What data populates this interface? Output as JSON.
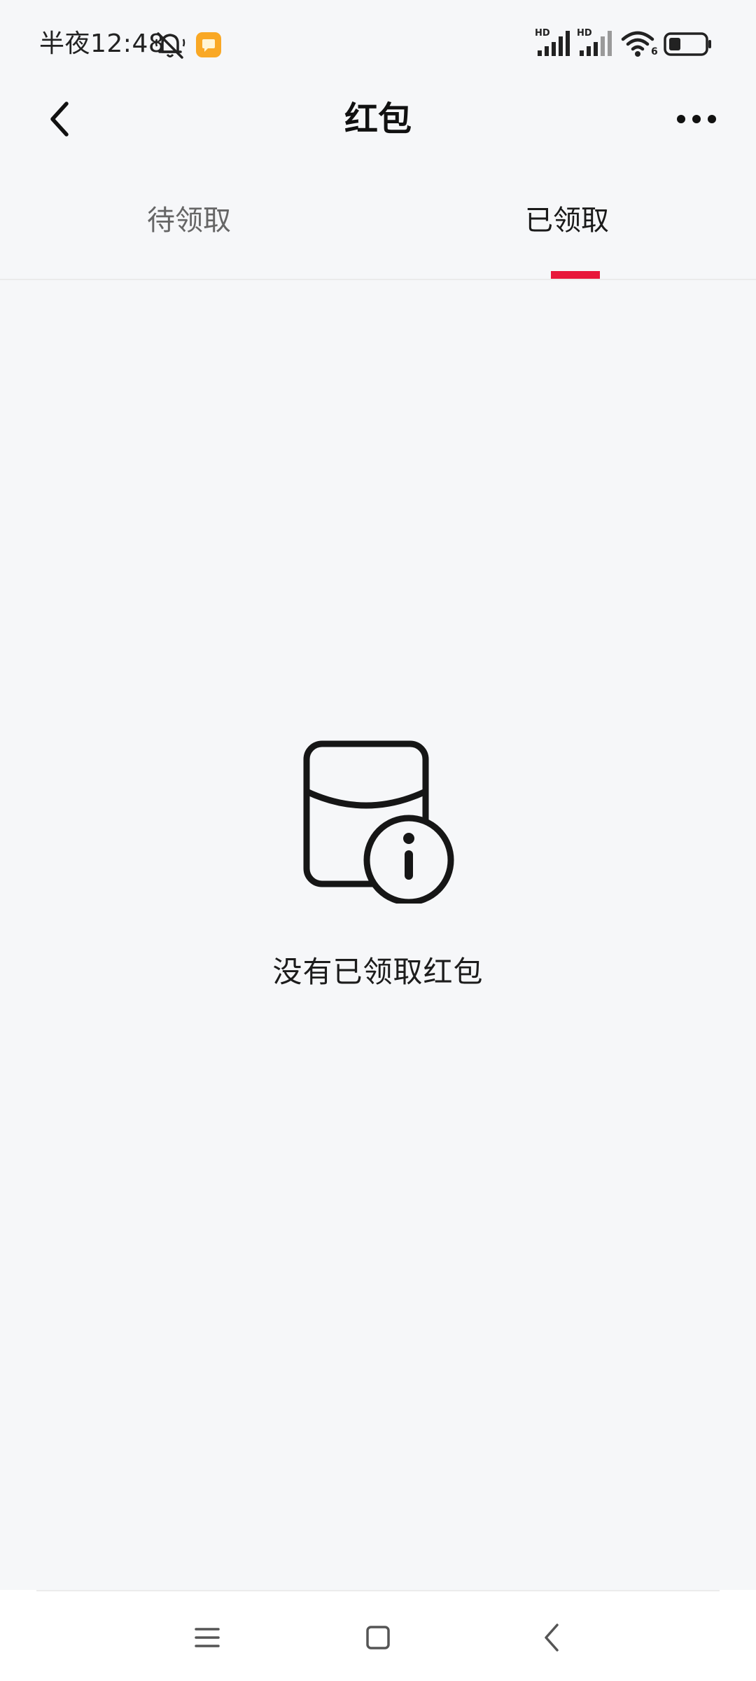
{
  "status_bar": {
    "time": "半夜12:48",
    "network_hd_1": "HD",
    "network_hd_2": "HD",
    "wifi_label": "6"
  },
  "header": {
    "title": "红包"
  },
  "tabs": [
    {
      "label": "待领取",
      "active": false
    },
    {
      "label": "已领取",
      "active": true
    }
  ],
  "empty_state": {
    "message": "没有已领取红包"
  },
  "colors": {
    "accent": "#e8173a",
    "background": "#f6f7f9",
    "notification_badge": "#f9a825"
  },
  "icons": {
    "back": "chevron-left-icon",
    "more": "more-horizontal-icon",
    "empty": "red-packet-info-icon",
    "nav_menu": "menu-icon",
    "nav_home": "home-square-icon",
    "nav_back": "back-triangle-icon"
  }
}
